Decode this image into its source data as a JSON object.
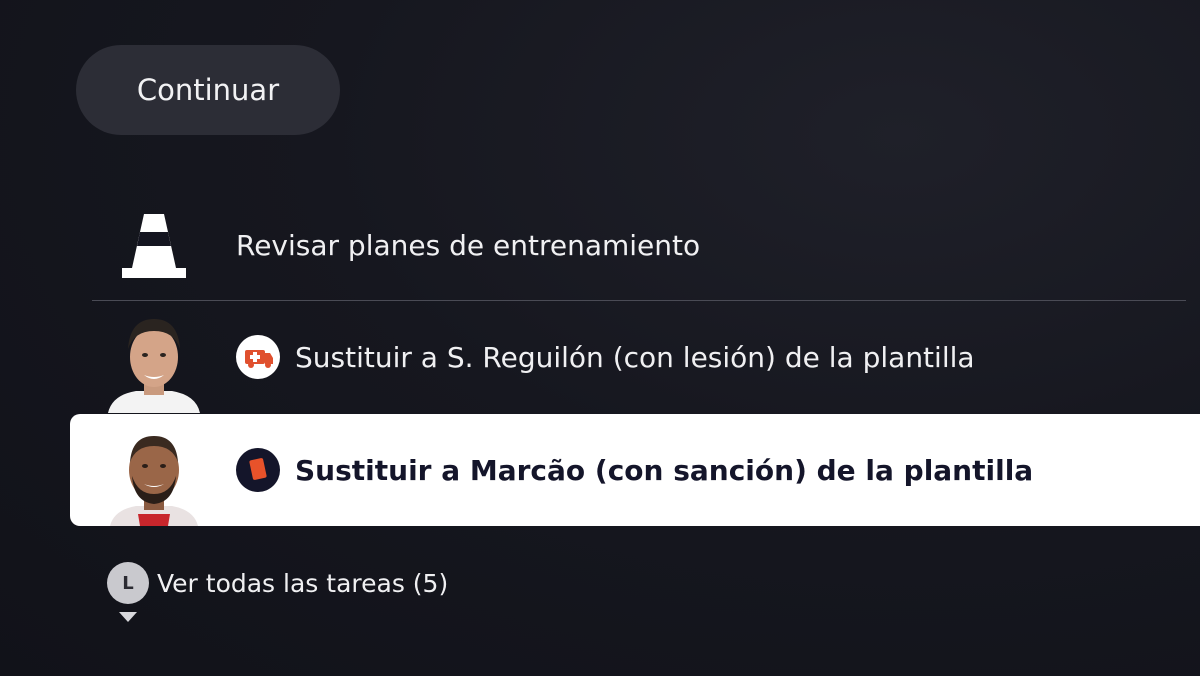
{
  "continue_button": {
    "label": "Continuar"
  },
  "tasks": [
    {
      "label": "Revisar planes de entrenamiento",
      "icon": "training-cone-icon"
    },
    {
      "label": "Sustituir a S. Reguilón (con lesión) de la plantilla",
      "icon": "ambulance-icon",
      "badge_color": "#e0502e"
    },
    {
      "label": "Sustituir a Marcão (con sanción) de la plantilla",
      "icon": "red-card-icon",
      "badge_color": "#e8522a",
      "selected": true
    }
  ],
  "footer": {
    "button_glyph": "L",
    "view_all_label": "Ver todas las tareas (5)"
  },
  "colors": {
    "background": "#141520",
    "pill": "#2c2d36",
    "selected_row": "#ffffff",
    "selected_text": "#14152a"
  }
}
